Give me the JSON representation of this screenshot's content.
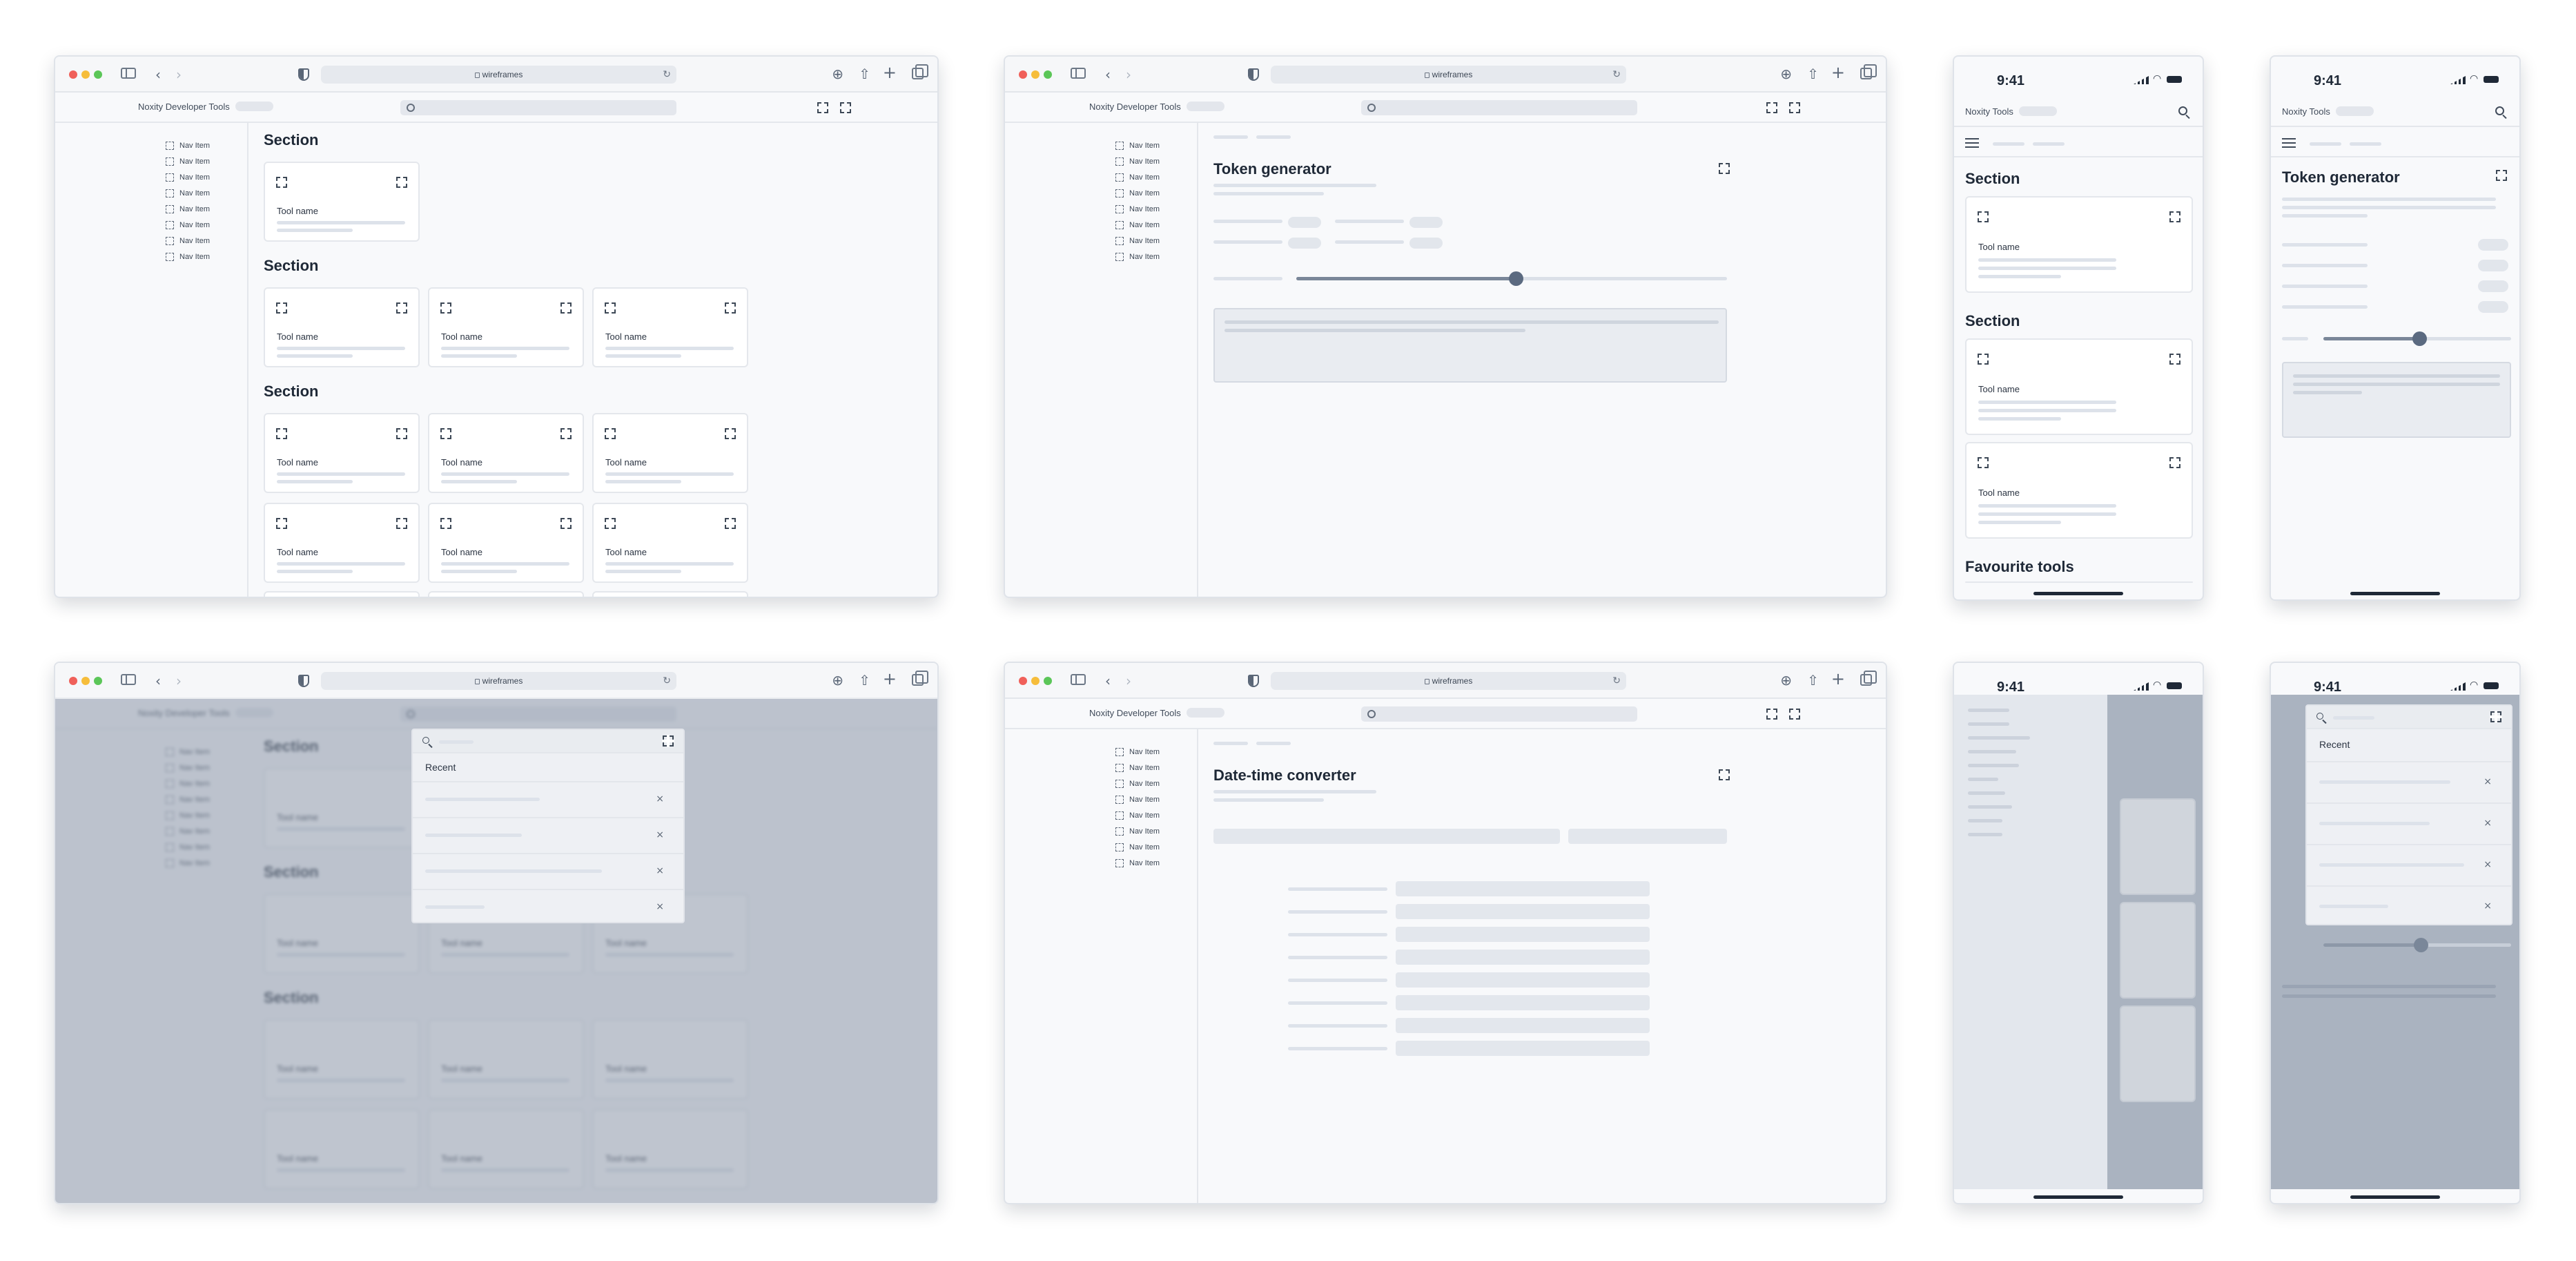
{
  "browser": {
    "url": "wireframes"
  },
  "app": {
    "name": "Noxity Developer Tools",
    "mobile_name": "Noxity Tools"
  },
  "nav": [
    "Nav Item",
    "Nav Item",
    "Nav Item",
    "Nav Item",
    "Nav Item",
    "Nav Item",
    "Nav Item",
    "Nav Item"
  ],
  "home": {
    "sections": [
      "Section",
      "Section",
      "Section"
    ],
    "tool_name": "Tool name",
    "mobile_extra_section": "Favourite tools"
  },
  "token": {
    "title": "Token generator",
    "slider_level": 0.51
  },
  "datetime": {
    "title": "Date-time converter"
  },
  "search": {
    "recent_label": "Recent"
  },
  "phone": {
    "time": "9:41"
  },
  "icons": {
    "expand": "expand-icon",
    "search": "search-icon",
    "menu": "hamburger-icon",
    "close": "close-icon"
  },
  "colors": {
    "accent": "#5b6a80",
    "overlay": "#8a96a8",
    "placeholder": "#dde2ea"
  }
}
